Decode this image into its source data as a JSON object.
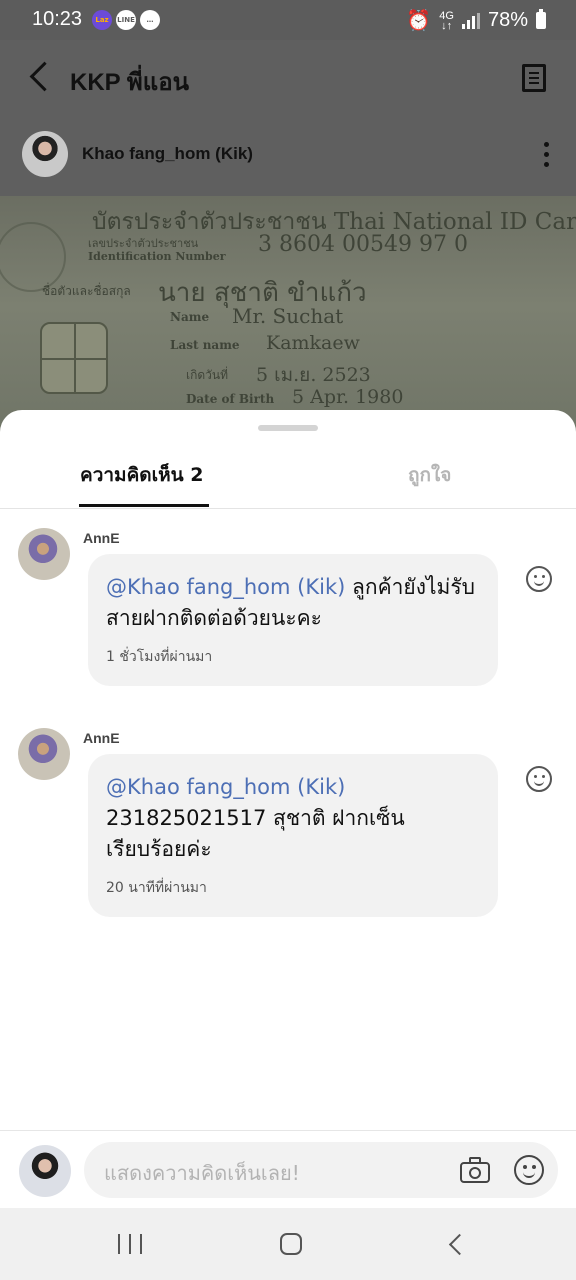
{
  "status_bar": {
    "time": "10:23",
    "network": "4G",
    "battery": "78%",
    "app_icons": [
      "lazada-icon",
      "line-icon",
      "chat-icon"
    ]
  },
  "header": {
    "title": "KKP พี่แอน"
  },
  "post": {
    "author_name": "Khao fang_hom (Kik)",
    "image_text": {
      "card_title": "บัตรประจำตัวประชาชน Thai National ID Card",
      "id_label_th": "เลขประจำตัวประชาชน",
      "id_label_en": "Identification Number",
      "id_number": "3 8604 00549 97 0",
      "name_label_th": "ชื่อตัวและชื่อสกุล",
      "name_th": "นาย สุชาติ ขำแก้ว",
      "name_label_en": "Name",
      "name_en": "Mr. Suchat",
      "lastname_label_en": "Last name",
      "lastname_en": "Kamkaew",
      "dob_label_th": "เกิดวันที่",
      "dob_th": "5 เม.ย. 2523",
      "dob_label_en": "Date of Birth",
      "dob_en": "5 Apr. 1980"
    }
  },
  "tabs": {
    "comments": "ความคิดเห็น 2",
    "likes": "ถูกใจ"
  },
  "comments": [
    {
      "author": "AnnE",
      "mention": "@Khao fang_hom (Kik)",
      "text": " ลูกค้ายังไม่รับสายฝากติดต่อด้วยนะคะ",
      "time": "1 ชั่วโมงที่ผ่านมา"
    },
    {
      "author": "AnnE",
      "mention": "@Khao fang_hom (Kik)",
      "text": "231825021517 สุชาติ ฝากเซ็นเรียบร้อยค่ะ",
      "time": "20 นาทีที่ผ่านมา"
    }
  ],
  "input": {
    "placeholder": "แสดงความคิดเห็นเลย!"
  },
  "colors": {
    "mention": "#4d6fb5",
    "overlay": "#5c5c5c",
    "bubble": "#f2f2f2"
  }
}
